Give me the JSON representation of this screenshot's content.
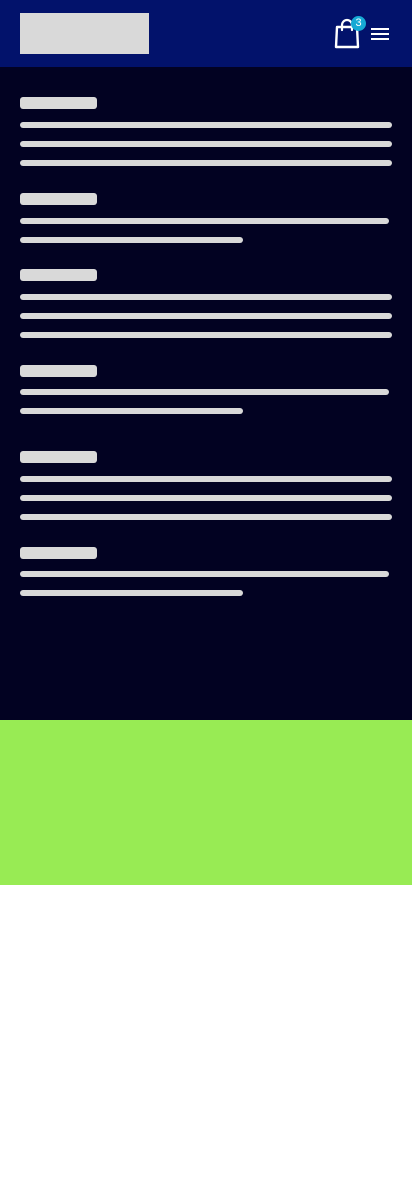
{
  "header": {
    "logo_icon": "logo-placeholder",
    "cart": {
      "icon": "shopping-bag-icon",
      "badge_count": "3",
      "badge_color": "#16a9d4"
    },
    "menu": {
      "icon": "hamburger-menu-icon"
    },
    "background_color": "#02126b"
  },
  "main": {
    "background_color": "#020222",
    "skeleton_color": "#d9d9d9",
    "sections": [
      {
        "title_placeholder": true,
        "line_count": 3
      },
      {
        "title_placeholder": true,
        "line_count": 2
      },
      {
        "title_placeholder": true,
        "line_count": 3
      },
      {
        "title_placeholder": true,
        "line_count": 2
      },
      {
        "title_placeholder": true,
        "line_count": 3
      },
      {
        "title_placeholder": true,
        "line_count": 2
      }
    ]
  },
  "footer": {
    "background_color": "#98eb54"
  }
}
